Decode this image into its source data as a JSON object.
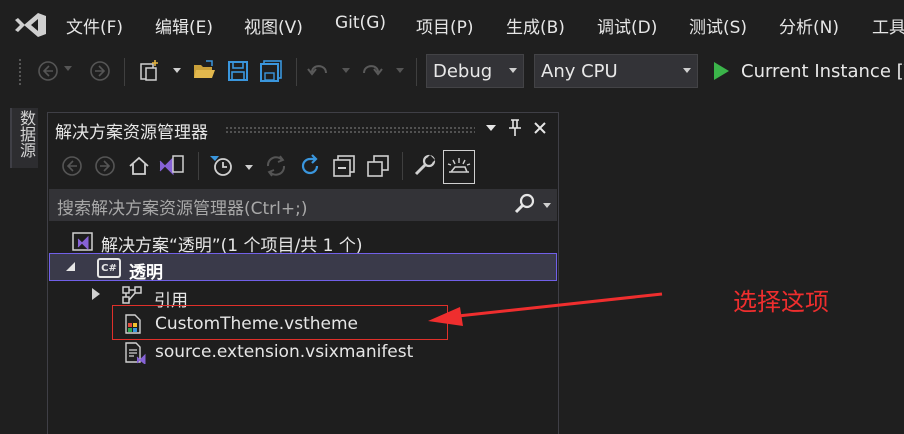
{
  "menubar": {
    "items": [
      "文件(F)",
      "编辑(E)",
      "视图(V)",
      "Git(G)",
      "项目(P)",
      "生成(B)",
      "调试(D)",
      "测试(S)",
      "分析(N)",
      "工具"
    ]
  },
  "toolbar": {
    "config_value": "Debug",
    "platform_value": "Any CPU",
    "start_label": "Current Instance [V"
  },
  "left_strip": {
    "vertical_tab": "数据源"
  },
  "solution_explorer": {
    "title": "解决方案资源管理器",
    "search_placeholder": "搜索解决方案资源管理器(Ctrl+;)",
    "tree": {
      "solution": "解决方案“透明”(1 个项目/共 1 个)",
      "project": "透明",
      "references": "引用",
      "files": [
        "CustomTheme.vstheme",
        "source.extension.vsixmanifest"
      ]
    }
  },
  "annotation": {
    "text": "选择这项"
  },
  "colors": {
    "accent": "#7160e8",
    "annotation": "#ef2e2e",
    "run_green": "#3bb44a",
    "save_blue": "#3a96dd"
  }
}
